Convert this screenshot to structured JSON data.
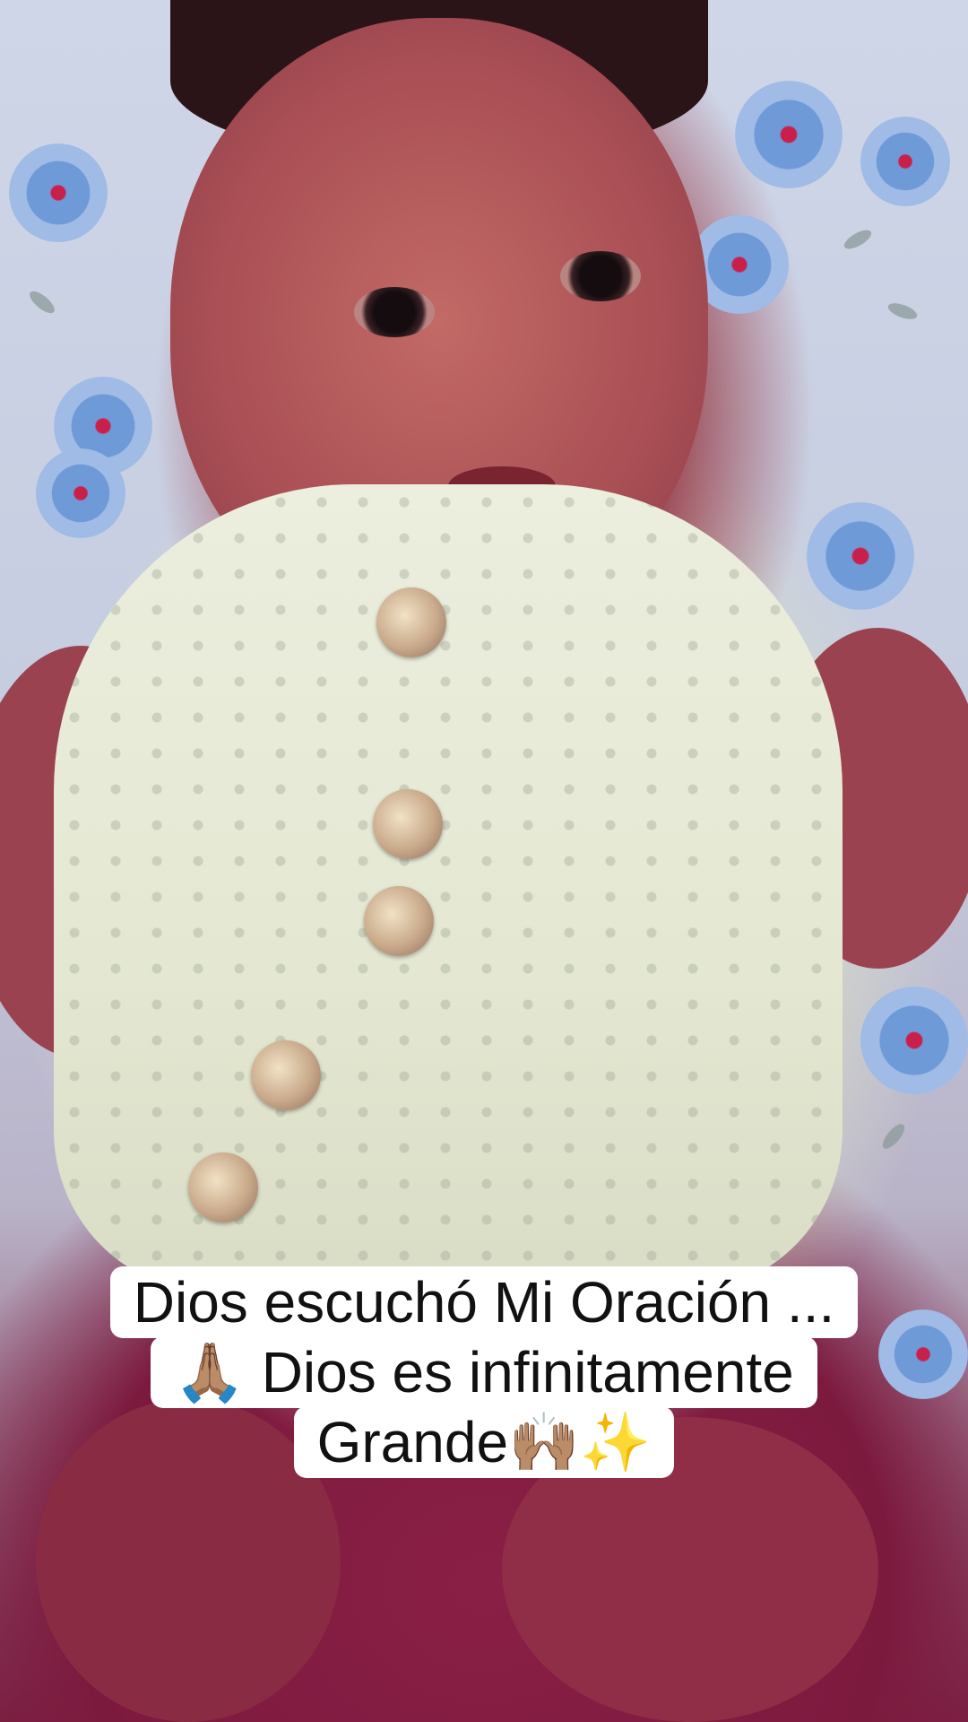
{
  "caption": {
    "lines": [
      "Dios escuchó Mi Oración ...",
      "🙏🏽 Dios es infinitamente",
      "Grande🙌🏽✨"
    ]
  }
}
